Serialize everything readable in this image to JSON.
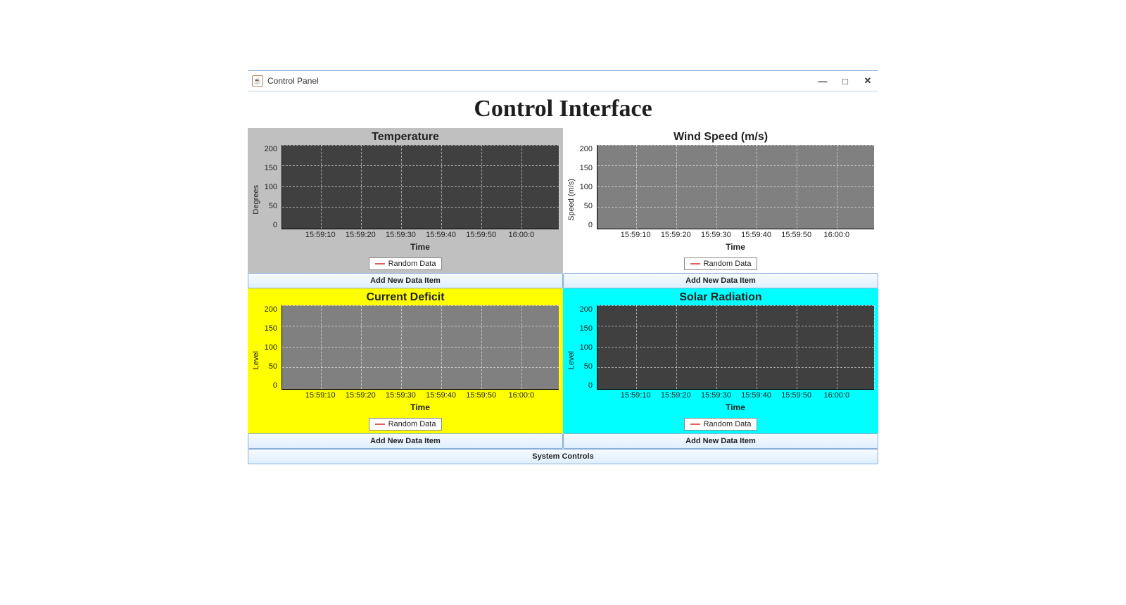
{
  "window": {
    "title": "Control Panel",
    "controls": {
      "min": "—",
      "max": "□",
      "close": "✕"
    }
  },
  "header": {
    "title": "Control Interface"
  },
  "panels": [
    {
      "id": "temperature",
      "title": "Temperature",
      "bg": "silver",
      "plot": "dark",
      "ylabel": "Degrees",
      "xlabel": "Time",
      "legend": "Random Data",
      "add_button": "Add New Data Item"
    },
    {
      "id": "wind-speed",
      "title": "Wind Speed (m/s)",
      "bg": "white",
      "plot": "gray",
      "ylabel": "Speed (m/s)",
      "xlabel": "Time",
      "legend": "Random Data",
      "add_button": "Add New Data Item"
    },
    {
      "id": "current-deficit",
      "title": "Current Deficit",
      "bg": "yellow",
      "plot": "gray",
      "ylabel": "Level",
      "xlabel": "Time",
      "legend": "Random Data",
      "add_button": "Add New Data Item"
    },
    {
      "id": "solar-radiation",
      "title": "Solar Radiation",
      "bg": "cyan",
      "plot": "dark",
      "ylabel": "Level",
      "xlabel": "Time",
      "legend": "Random Data",
      "add_button": "Add New Data Item"
    }
  ],
  "axes": {
    "y_ticks": [
      "200",
      "150",
      "100",
      "50",
      "0"
    ],
    "x_ticks": [
      "15:59:10",
      "15:59:20",
      "15:59:30",
      "15:59:40",
      "15:59:50",
      "16:00:0"
    ]
  },
  "system_controls_button": "System Controls",
  "chart_data": [
    {
      "panel": "temperature",
      "type": "line",
      "title": "Temperature",
      "xlabel": "Time",
      "ylabel": "Degrees",
      "ylim": [
        0,
        200
      ],
      "x_ticks": [
        "15:59:10",
        "15:59:20",
        "15:59:30",
        "15:59:40",
        "15:59:50",
        "16:00:00"
      ],
      "series": [
        {
          "name": "Random Data",
          "values": []
        }
      ]
    },
    {
      "panel": "wind-speed",
      "type": "line",
      "title": "Wind Speed (m/s)",
      "xlabel": "Time",
      "ylabel": "Speed (m/s)",
      "ylim": [
        0,
        200
      ],
      "x_ticks": [
        "15:59:10",
        "15:59:20",
        "15:59:30",
        "15:59:40",
        "15:59:50",
        "16:00:00"
      ],
      "series": [
        {
          "name": "Random Data",
          "values": []
        }
      ]
    },
    {
      "panel": "current-deficit",
      "type": "line",
      "title": "Current Deficit",
      "xlabel": "Time",
      "ylabel": "Level",
      "ylim": [
        0,
        200
      ],
      "x_ticks": [
        "15:59:10",
        "15:59:20",
        "15:59:30",
        "15:59:40",
        "15:59:50",
        "16:00:00"
      ],
      "series": [
        {
          "name": "Random Data",
          "values": []
        }
      ]
    },
    {
      "panel": "solar-radiation",
      "type": "line",
      "title": "Solar Radiation",
      "xlabel": "Time",
      "ylabel": "Level",
      "ylim": [
        0,
        200
      ],
      "x_ticks": [
        "15:59:10",
        "15:59:20",
        "15:59:30",
        "15:59:40",
        "15:59:50",
        "16:00:00"
      ],
      "series": [
        {
          "name": "Random Data",
          "values": []
        }
      ]
    }
  ]
}
